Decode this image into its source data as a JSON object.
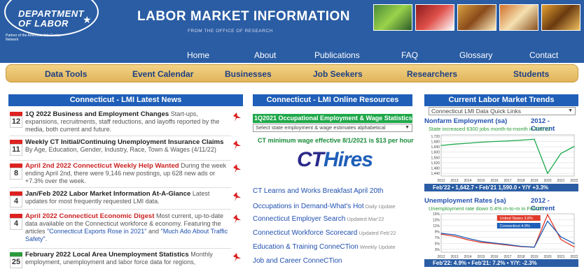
{
  "header": {
    "logo_line1": "CONNECTICUT",
    "logo_line2": "DEPARTMENT",
    "logo_line3": "OF LABOR",
    "logo_ajc": "Partner of the American Job Center Network",
    "title": "LABOR MARKET INFORMATION",
    "subtitle": "FROM THE OFFICE OF RESEARCH"
  },
  "nav_primary": [
    "Home",
    "About",
    "Publications",
    "FAQ",
    "Glossary",
    "Contact"
  ],
  "nav_secondary": [
    "Data Tools",
    "Event Calendar",
    "Businesses",
    "Job Seekers",
    "Researchers",
    "Students"
  ],
  "news": {
    "header": "Connecticut - LMI Latest News",
    "items": [
      {
        "day": "12",
        "title": "1Q 2022 Business and Employment Changes",
        "text": " Start-ups, expansions, recruitments, staff reductions, and layoffs reported by the media, both current and future."
      },
      {
        "day": "11",
        "title": "Weekly CT Initial/Continuing Unemployment Insurance Claims",
        "text": " By Age, Education, Gender, Industry, Race, Town & Wages (4/11/22)"
      },
      {
        "day": "8",
        "title": "April 2nd 2022 Connecticut Weekly Help Wanted",
        "text": " During the week ending April 2nd, there were 9,146 new postings, up 628 new ads or +7.3% over the week."
      },
      {
        "day": "4",
        "title": "Jan/Feb 2022 Labor Market Information At-A-Glance",
        "text": " Latest updates for most frequently requested LMI data."
      },
      {
        "day": "4",
        "title": "April 2022 Connecticut Economic Digest",
        "text": " Most current, up-to-date data available on the Connecticut workforce & economy. Featuring the articles ",
        "link1": "\"Connecticut Exports Rose in 2021\"",
        "and": " and ",
        "link2": "\"Much Ado About Traffic Safety\"",
        "end": "."
      },
      {
        "day": "25",
        "title": "February 2022 Local Area Unemployment Statistics",
        "text": " Monthly employment, unemployment and labor force data for regions,"
      }
    ]
  },
  "resources": {
    "header": "Connecticut - LMI Online Resources",
    "oews_title": "1Q2021 Occupational Employment & Wage Statistics",
    "oews_select": "Select state employment & wage estimates alphabetical",
    "min_wage": "CT minimum wage effective 8/1/2021 is $13 per hour",
    "cthires_ct": "CT",
    "cthires_rest": "Hires",
    "links": [
      {
        "text": "CT Learns and Works Breakfast April 20th",
        "update": ""
      },
      {
        "text": "Occupations in Demand-What's Hot",
        "update": " Daily Update"
      },
      {
        "text": "Connecticut Employer Search",
        "update": " Updated Mar'22"
      },
      {
        "text": "Connecticut Workforce Scorecard",
        "update": " Updated Feb'22"
      },
      {
        "text": "Education & Training ConneCTion",
        "update": " Weekly Update"
      },
      {
        "text": "Job and Career ConneCTion",
        "update": ""
      }
    ]
  },
  "trends": {
    "header": "Current Labor Market Trends",
    "quick_links": "Connecticut LMI Data Quick Links",
    "nonfarm_title": "Nonfarm Employment (sa)",
    "nonfarm_range": "2012 - Current",
    "nonfarm_sub": "State increased 6300 jobs month-to-month in Feb'22",
    "nonfarm_stat": "Feb'22 • 1,642.7 • Feb'21 1,590.0 • Y/Y +3.3%",
    "unemp_title": "Unemployment Rates (sa)",
    "unemp_range": "2012 - Current",
    "unemp_sub": "Unemployment rate down 0.4% m-to-m in Feb'22",
    "unemp_stat": "Feb'22: 4.9%  •  Feb'21: 7.2%  •  Y/Y: -2.3%",
    "legend_us": "United States 3.8%",
    "legend_ct": "Connecticut 4.9%"
  },
  "chart_data": [
    {
      "type": "line",
      "title": "Nonfarm Employment (sa)",
      "x": [
        "2012",
        "2013",
        "2014",
        "2015",
        "2016",
        "2017",
        "2018",
        "2019",
        "2020",
        "2021",
        "2022"
      ],
      "ytick_labels": [
        "1,440",
        "1,480",
        "1,520",
        "1,560",
        "1,600",
        "1,640",
        "1,680",
        "1,720"
      ],
      "ylim": [
        1420,
        1730
      ],
      "series": [
        {
          "name": "",
          "values": [
            1650,
            1660,
            1667,
            1675,
            1680,
            1684,
            1690,
            1697,
            1440,
            1590,
            1642.7
          ]
        }
      ],
      "colors": {
        "line": "#1aa84a",
        "fill": "#ffffff"
      }
    },
    {
      "type": "line",
      "title": "Unemployment Rates (sa)",
      "x": [
        "2012",
        "2013",
        "2014",
        "2015",
        "2016",
        "2017",
        "2018",
        "2019",
        "2020",
        "2021",
        "2022"
      ],
      "ytick_labels": [
        "3%",
        "5%",
        "7%",
        "9%",
        "11%",
        "13%",
        "15%"
      ],
      "ylim": [
        2,
        15
      ],
      "series": [
        {
          "name": "United States",
          "values": [
            8.1,
            7.4,
            6.2,
            5.3,
            4.9,
            4.4,
            3.9,
            3.7,
            14.7,
            6.3,
            3.8
          ]
        },
        {
          "name": "Connecticut",
          "values": [
            8.4,
            7.9,
            6.7,
            5.7,
            5.1,
            4.6,
            4.0,
            3.7,
            12.5,
            7.2,
            4.9
          ]
        }
      ],
      "colors": {
        "United States": "#e03a2a",
        "Connecticut": "#1f5fb8"
      }
    }
  ]
}
